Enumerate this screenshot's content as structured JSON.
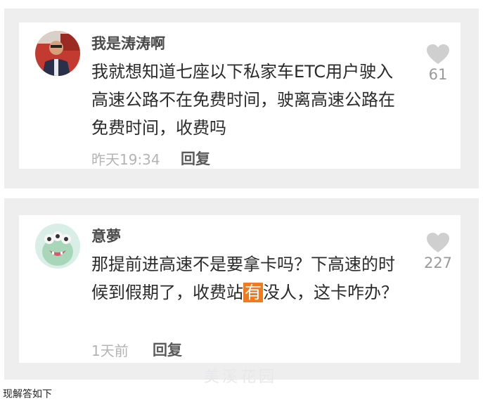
{
  "comments": [
    {
      "username": "我是涛涛啊",
      "content": "我就想知道七座以下私家车ETC用户驶入高速公路不在免费时间，驶离高速公路在免费时间，收费吗",
      "time": "昨天19:34",
      "reply_label": "回复",
      "likes": "61",
      "avatar": "person-photo"
    },
    {
      "username": "意夢",
      "content_before": "那提前进高速不是要拿卡吗？下高速的时候到假期了，收费站",
      "content_highlight": "有",
      "content_after": "没人，这卡咋办？",
      "time": "1天前",
      "reply_label": "回复",
      "likes": "227",
      "avatar": "green-monster-icon"
    }
  ],
  "footer_text": "现解答如下",
  "watermark": "美溪花园",
  "colors": {
    "panel_bg": "#eeeeef",
    "card_bg": "#ffffff",
    "highlight": "#f07a1e",
    "heart": "#cfcfcf"
  }
}
